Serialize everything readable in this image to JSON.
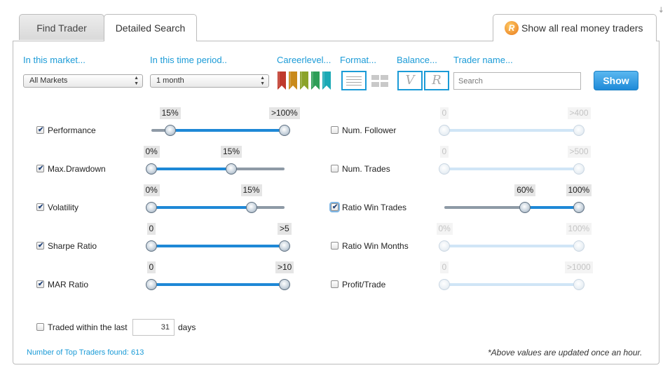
{
  "tabs": {
    "find_trader": "Find Trader",
    "detailed_search": "Detailed Search",
    "real_money": "Show all real money traders"
  },
  "filters": {
    "market_label": "In this market...",
    "market_value": "All Markets",
    "period_label": "In this time period..",
    "period_value": "1 month",
    "careerlevel_label": "Careerlevel...",
    "format_label": "Format...",
    "balance_label": "Balance...",
    "trader_name_label": "Trader name...",
    "search_placeholder": "Search",
    "show_button": "Show"
  },
  "career_colors": [
    "#c0392b",
    "#c98a1a",
    "#8ba32a",
    "#2e9e57",
    "#1ba9b5"
  ],
  "balance_icons": {
    "virtual": "V",
    "real": "R"
  },
  "criteria": [
    {
      "label": "Performance",
      "checked": true,
      "min_label": "15%",
      "max_label": ">100%",
      "low": 0.14,
      "high": 1.0
    },
    {
      "label": "Max.Drawdown",
      "checked": true,
      "min_label": "0%",
      "max_label": "15%",
      "low": 0.0,
      "high": 0.6
    },
    {
      "label": "Volatility",
      "checked": true,
      "min_label": "0%",
      "max_label": "15%",
      "low": 0.0,
      "high": 0.75
    },
    {
      "label": "Sharpe Ratio",
      "checked": true,
      "min_label": "0",
      "max_label": ">5",
      "low": 0.0,
      "high": 1.0
    },
    {
      "label": "MAR Ratio",
      "checked": true,
      "min_label": "0",
      "max_label": ">10",
      "low": 0.0,
      "high": 1.0
    },
    {
      "label": "Num. Follower",
      "checked": false,
      "min_label": "0",
      "max_label": ">400",
      "low": 0.0,
      "high": 1.0
    },
    {
      "label": "Num. Trades",
      "checked": false,
      "min_label": "0",
      "max_label": ">500",
      "low": 0.0,
      "high": 1.0
    },
    {
      "label": "Ratio Win Trades",
      "checked": true,
      "min_label": "60%",
      "max_label": "100%",
      "low": 0.6,
      "high": 1.0
    },
    {
      "label": "Ratio Win Months",
      "checked": false,
      "min_label": "0%",
      "max_label": "100%",
      "low": 0.0,
      "high": 1.0
    },
    {
      "label": "Profit/Trade",
      "checked": false,
      "min_label": "0",
      "max_label": ">1000",
      "low": 0.0,
      "high": 1.0
    }
  ],
  "traded_within": {
    "label": "Traded within the last",
    "value": "31",
    "unit": "days",
    "checked": false
  },
  "footer": {
    "found": "Number of Top Traders found: 613",
    "note": "*Above values are updated once an hour."
  }
}
